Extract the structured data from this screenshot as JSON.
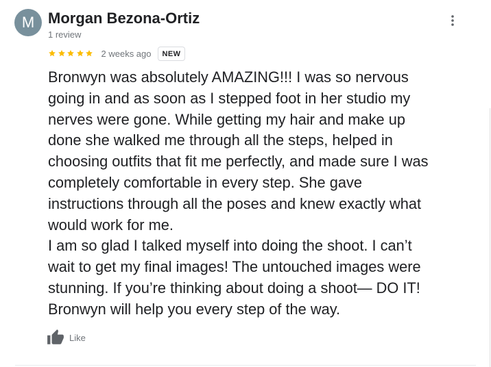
{
  "reviewer": {
    "initial": "M",
    "name": "Morgan Bezona-Ortiz",
    "review_count": "1 review",
    "avatar_color": "#78909c"
  },
  "review": {
    "rating": 5,
    "star_color": "#fbbc04",
    "timestamp": "2 weeks ago",
    "badge": "NEW",
    "lines": [
      "Bronwyn was absolutely AMAZING!!! I was so nervous",
      "going in and as soon as I stepped foot in her studio my",
      "nerves were gone. While getting my hair and make up",
      "done she walked me through all the steps, helped in",
      "choosing outfits that fit me perfectly, and made sure I was",
      "completely comfortable in every step. She gave",
      "instructions through all the poses and knew exactly what",
      "would work for me.",
      "I am so glad I talked myself into doing the shoot. I can’t",
      "wait to get my final images! The untouched images were",
      "stunning. If you’re thinking about doing a shoot— DO IT!",
      "Bronwyn will help you every step of the way."
    ]
  },
  "actions": {
    "like_label": "Like",
    "like_icon": "thumbs-up-icon",
    "more_icon": "more-vertical-icon"
  }
}
